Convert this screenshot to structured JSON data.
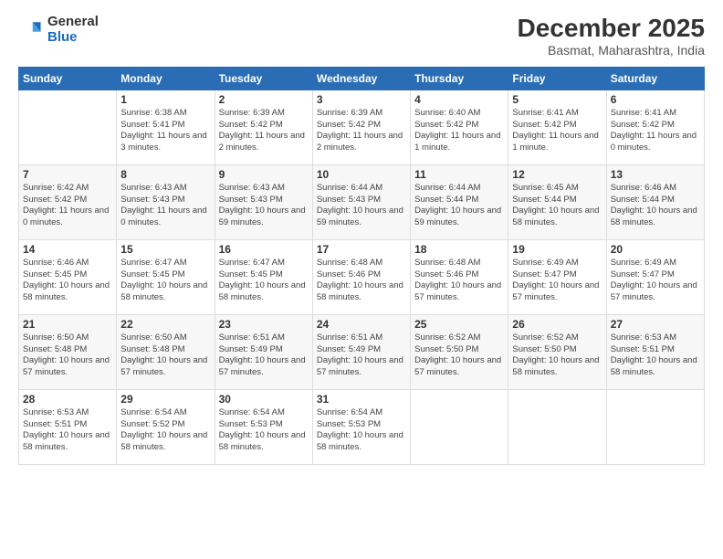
{
  "logo": {
    "general": "General",
    "blue": "Blue"
  },
  "title": "December 2025",
  "subtitle": "Basmat, Maharashtra, India",
  "header_days": [
    "Sunday",
    "Monday",
    "Tuesday",
    "Wednesday",
    "Thursday",
    "Friday",
    "Saturday"
  ],
  "weeks": [
    [
      {
        "day": "",
        "sunrise": "",
        "sunset": "",
        "daylight": ""
      },
      {
        "day": "1",
        "sunrise": "Sunrise: 6:38 AM",
        "sunset": "Sunset: 5:41 PM",
        "daylight": "Daylight: 11 hours and 3 minutes."
      },
      {
        "day": "2",
        "sunrise": "Sunrise: 6:39 AM",
        "sunset": "Sunset: 5:42 PM",
        "daylight": "Daylight: 11 hours and 2 minutes."
      },
      {
        "day": "3",
        "sunrise": "Sunrise: 6:39 AM",
        "sunset": "Sunset: 5:42 PM",
        "daylight": "Daylight: 11 hours and 2 minutes."
      },
      {
        "day": "4",
        "sunrise": "Sunrise: 6:40 AM",
        "sunset": "Sunset: 5:42 PM",
        "daylight": "Daylight: 11 hours and 1 minute."
      },
      {
        "day": "5",
        "sunrise": "Sunrise: 6:41 AM",
        "sunset": "Sunset: 5:42 PM",
        "daylight": "Daylight: 11 hours and 1 minute."
      },
      {
        "day": "6",
        "sunrise": "Sunrise: 6:41 AM",
        "sunset": "Sunset: 5:42 PM",
        "daylight": "Daylight: 11 hours and 0 minutes."
      }
    ],
    [
      {
        "day": "7",
        "sunrise": "Sunrise: 6:42 AM",
        "sunset": "Sunset: 5:42 PM",
        "daylight": "Daylight: 11 hours and 0 minutes."
      },
      {
        "day": "8",
        "sunrise": "Sunrise: 6:43 AM",
        "sunset": "Sunset: 5:43 PM",
        "daylight": "Daylight: 11 hours and 0 minutes."
      },
      {
        "day": "9",
        "sunrise": "Sunrise: 6:43 AM",
        "sunset": "Sunset: 5:43 PM",
        "daylight": "Daylight: 10 hours and 59 minutes."
      },
      {
        "day": "10",
        "sunrise": "Sunrise: 6:44 AM",
        "sunset": "Sunset: 5:43 PM",
        "daylight": "Daylight: 10 hours and 59 minutes."
      },
      {
        "day": "11",
        "sunrise": "Sunrise: 6:44 AM",
        "sunset": "Sunset: 5:44 PM",
        "daylight": "Daylight: 10 hours and 59 minutes."
      },
      {
        "day": "12",
        "sunrise": "Sunrise: 6:45 AM",
        "sunset": "Sunset: 5:44 PM",
        "daylight": "Daylight: 10 hours and 58 minutes."
      },
      {
        "day": "13",
        "sunrise": "Sunrise: 6:46 AM",
        "sunset": "Sunset: 5:44 PM",
        "daylight": "Daylight: 10 hours and 58 minutes."
      }
    ],
    [
      {
        "day": "14",
        "sunrise": "Sunrise: 6:46 AM",
        "sunset": "Sunset: 5:45 PM",
        "daylight": "Daylight: 10 hours and 58 minutes."
      },
      {
        "day": "15",
        "sunrise": "Sunrise: 6:47 AM",
        "sunset": "Sunset: 5:45 PM",
        "daylight": "Daylight: 10 hours and 58 minutes."
      },
      {
        "day": "16",
        "sunrise": "Sunrise: 6:47 AM",
        "sunset": "Sunset: 5:45 PM",
        "daylight": "Daylight: 10 hours and 58 minutes."
      },
      {
        "day": "17",
        "sunrise": "Sunrise: 6:48 AM",
        "sunset": "Sunset: 5:46 PM",
        "daylight": "Daylight: 10 hours and 58 minutes."
      },
      {
        "day": "18",
        "sunrise": "Sunrise: 6:48 AM",
        "sunset": "Sunset: 5:46 PM",
        "daylight": "Daylight: 10 hours and 57 minutes."
      },
      {
        "day": "19",
        "sunrise": "Sunrise: 6:49 AM",
        "sunset": "Sunset: 5:47 PM",
        "daylight": "Daylight: 10 hours and 57 minutes."
      },
      {
        "day": "20",
        "sunrise": "Sunrise: 6:49 AM",
        "sunset": "Sunset: 5:47 PM",
        "daylight": "Daylight: 10 hours and 57 minutes."
      }
    ],
    [
      {
        "day": "21",
        "sunrise": "Sunrise: 6:50 AM",
        "sunset": "Sunset: 5:48 PM",
        "daylight": "Daylight: 10 hours and 57 minutes."
      },
      {
        "day": "22",
        "sunrise": "Sunrise: 6:50 AM",
        "sunset": "Sunset: 5:48 PM",
        "daylight": "Daylight: 10 hours and 57 minutes."
      },
      {
        "day": "23",
        "sunrise": "Sunrise: 6:51 AM",
        "sunset": "Sunset: 5:49 PM",
        "daylight": "Daylight: 10 hours and 57 minutes."
      },
      {
        "day": "24",
        "sunrise": "Sunrise: 6:51 AM",
        "sunset": "Sunset: 5:49 PM",
        "daylight": "Daylight: 10 hours and 57 minutes."
      },
      {
        "day": "25",
        "sunrise": "Sunrise: 6:52 AM",
        "sunset": "Sunset: 5:50 PM",
        "daylight": "Daylight: 10 hours and 57 minutes."
      },
      {
        "day": "26",
        "sunrise": "Sunrise: 6:52 AM",
        "sunset": "Sunset: 5:50 PM",
        "daylight": "Daylight: 10 hours and 58 minutes."
      },
      {
        "day": "27",
        "sunrise": "Sunrise: 6:53 AM",
        "sunset": "Sunset: 5:51 PM",
        "daylight": "Daylight: 10 hours and 58 minutes."
      }
    ],
    [
      {
        "day": "28",
        "sunrise": "Sunrise: 6:53 AM",
        "sunset": "Sunset: 5:51 PM",
        "daylight": "Daylight: 10 hours and 58 minutes."
      },
      {
        "day": "29",
        "sunrise": "Sunrise: 6:54 AM",
        "sunset": "Sunset: 5:52 PM",
        "daylight": "Daylight: 10 hours and 58 minutes."
      },
      {
        "day": "30",
        "sunrise": "Sunrise: 6:54 AM",
        "sunset": "Sunset: 5:53 PM",
        "daylight": "Daylight: 10 hours and 58 minutes."
      },
      {
        "day": "31",
        "sunrise": "Sunrise: 6:54 AM",
        "sunset": "Sunset: 5:53 PM",
        "daylight": "Daylight: 10 hours and 58 minutes."
      },
      {
        "day": "",
        "sunrise": "",
        "sunset": "",
        "daylight": ""
      },
      {
        "day": "",
        "sunrise": "",
        "sunset": "",
        "daylight": ""
      },
      {
        "day": "",
        "sunrise": "",
        "sunset": "",
        "daylight": ""
      }
    ]
  ]
}
